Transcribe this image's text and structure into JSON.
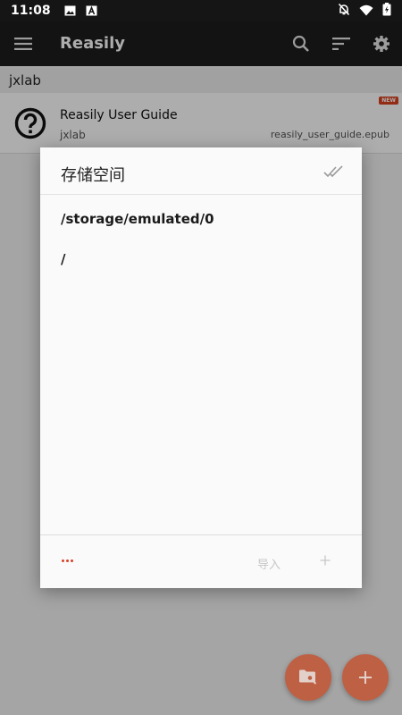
{
  "status_bar": {
    "time": "11:08"
  },
  "app_bar": {
    "title": "Reasily"
  },
  "library": {
    "section_label": "jxlab",
    "book": {
      "title": "Reasily User Guide",
      "author": "jxlab",
      "filename": "reasily_user_guide.epub",
      "badge": "NEW"
    }
  },
  "dialog": {
    "title": "存储空间",
    "current_path": "/storage/emulated/0",
    "entries": [
      "/"
    ],
    "footer": {
      "import_label": "导入"
    }
  },
  "colors": {
    "accent": "#c54f2b",
    "app_bar": "#1d1d1d",
    "status_bar": "#151515",
    "badge": "#d9421f",
    "menu_dots": "#d7422a"
  }
}
